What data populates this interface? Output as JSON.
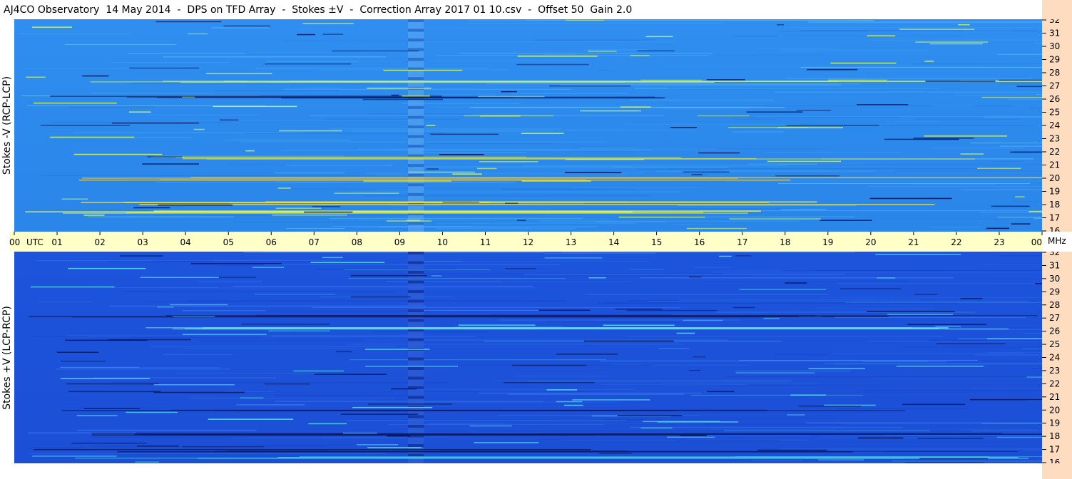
{
  "title": "AJ4CO Observatory  14 May 2014  -  DPS on TFD Array  -  Stokes ±V  -  Correction Array 2017 01 10.csv  -  Offset 50  Gain 2.0",
  "chart_data": [
    {
      "type": "heatmap",
      "ylabel": "Stokes -V (RCP-LCP)",
      "x_ticks": [
        "00",
        "01",
        "02",
        "03",
        "04",
        "05",
        "06",
        "07",
        "08",
        "09",
        "10",
        "11",
        "12",
        "13",
        "14",
        "15",
        "16",
        "17",
        "18",
        "19",
        "20",
        "21",
        "22",
        "23",
        "00"
      ],
      "x_unit": "UTC",
      "y_ticks": [
        16,
        17,
        18,
        19,
        20,
        21,
        22,
        23,
        24,
        25,
        26,
        27,
        28,
        29,
        30,
        31,
        32
      ],
      "y_unit": "MHz",
      "xlim": [
        0,
        24
      ],
      "ylim": [
        16,
        32
      ],
      "background_color": "#2f8ef0",
      "strong_features": [
        {
          "freq_mhz": 18.2,
          "color": "#f0e040"
        },
        {
          "freq_mhz": 17.5,
          "color": "#e8f040"
        },
        {
          "freq_mhz": 20.0,
          "color": "#f0c830"
        },
        {
          "freq_mhz": 21.6,
          "color": "#d8e040"
        },
        {
          "freq_mhz": 27.3,
          "color": "#c8f070"
        },
        {
          "freq_mhz": 26.2,
          "color": "#0a1a6a"
        }
      ]
    },
    {
      "type": "heatmap",
      "ylabel": "Stokes +V (LCP-RCP)",
      "x_ticks": [
        "00",
        "01",
        "02",
        "03",
        "04",
        "05",
        "06",
        "07",
        "08",
        "09",
        "10",
        "11",
        "12",
        "13",
        "14",
        "15",
        "16",
        "17",
        "18",
        "19",
        "20",
        "21",
        "22",
        "23",
        "00"
      ],
      "x_unit": "UTC",
      "y_ticks": [
        16,
        17,
        18,
        19,
        20,
        21,
        22,
        23,
        24,
        25,
        26,
        27,
        28,
        29,
        30,
        31,
        32
      ],
      "y_unit": "MHz",
      "xlim": [
        0,
        24
      ],
      "ylim": [
        16,
        32
      ],
      "background_color": "#1d54dc",
      "strong_features": [
        {
          "freq_mhz": 18.2,
          "color": "#0a1a6a"
        },
        {
          "freq_mhz": 17.0,
          "color": "#0a1a6a"
        },
        {
          "freq_mhz": 20.0,
          "color": "#0a1a6a"
        },
        {
          "freq_mhz": 27.2,
          "color": "#0a1a6a"
        },
        {
          "freq_mhz": 26.3,
          "color": "#60e8d0"
        },
        {
          "freq_mhz": 16.5,
          "color": "#40c8e0"
        }
      ]
    }
  ]
}
